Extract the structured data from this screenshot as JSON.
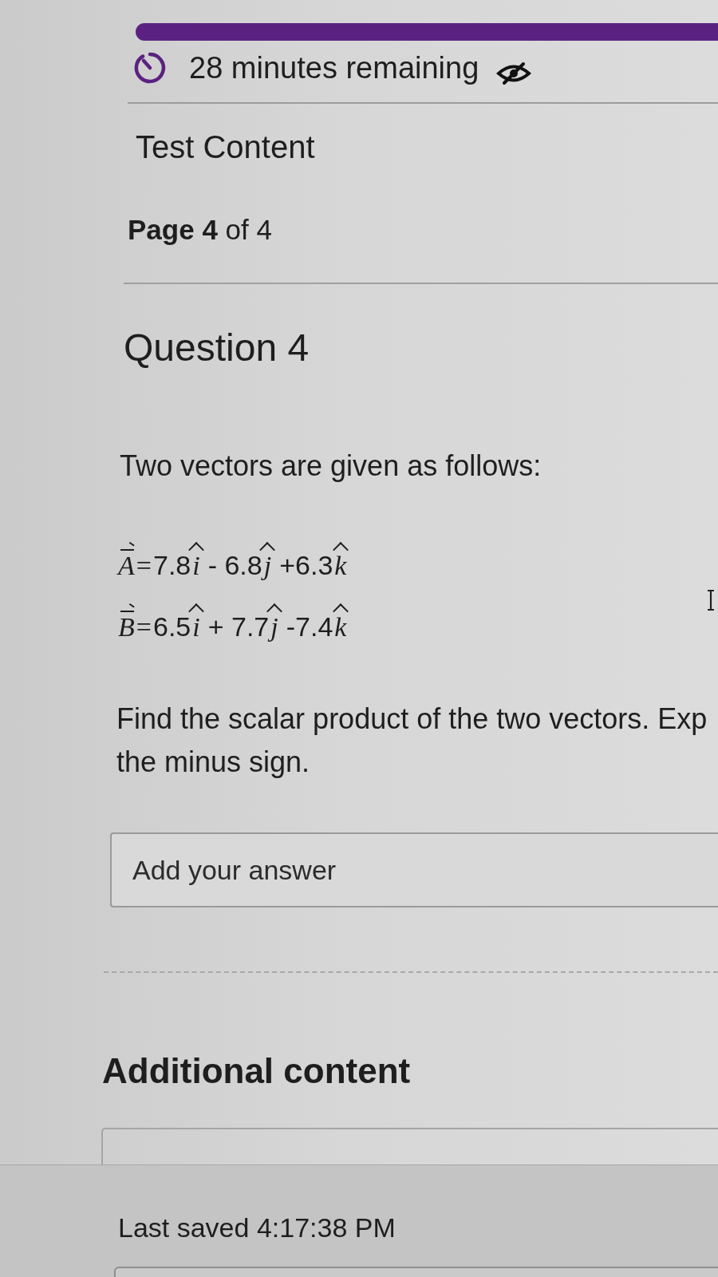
{
  "header": {
    "timer": {
      "text": "28 minutes remaining"
    }
  },
  "section_title": "Test Content",
  "pagination": "**Page 4** of 4",
  "question": {
    "title": "Question 4",
    "intro": "Two vectors are given as follows:",
    "equations": [
      {
        "symbol": "A",
        "equals": "=",
        "terms": [
          {
            "coefficient": "7.8",
            "unit": "i"
          },
          {
            "coefficient": "- 6.8",
            "unit": "j"
          },
          {
            "coefficient": "+6.3",
            "unit": "k"
          }
        ]
      },
      {
        "symbol": "B",
        "equals": "=",
        "terms": [
          {
            "coefficient": "6.5",
            "unit": "i"
          },
          {
            "coefficient": "+ 7.7",
            "unit": "j"
          },
          {
            "coefficient": "-7.4",
            "unit": "k"
          }
        ]
      }
    ],
    "prompt_lines": [
      "Find the scalar product of the two vectors. Exp",
      "the minus sign."
    ],
    "answer": {
      "placeholder": "Add your answer"
    }
  },
  "additional_content": {
    "title": "Additional content"
  },
  "footer": {
    "last_saved": "Last saved 4:17:38 PM"
  }
}
